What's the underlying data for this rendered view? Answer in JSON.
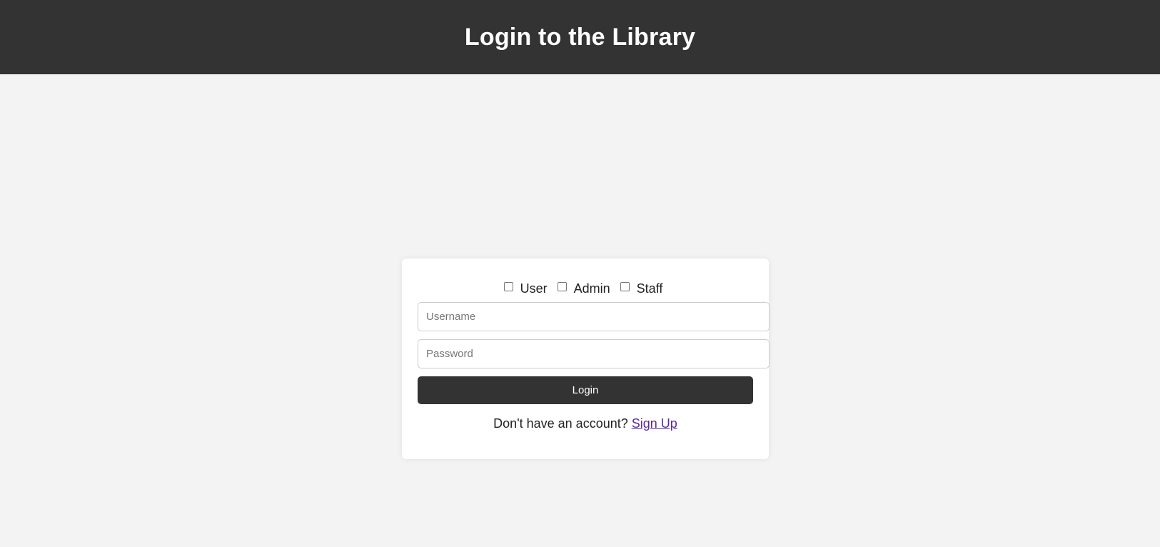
{
  "header": {
    "title": "Login to the Library"
  },
  "roles": [
    {
      "label": "User",
      "checked": false
    },
    {
      "label": "Admin",
      "checked": false
    },
    {
      "label": "Staff",
      "checked": false
    }
  ],
  "form": {
    "username_placeholder": "Username",
    "username_value": "",
    "password_placeholder": "Password",
    "password_value": "",
    "login_label": "Login"
  },
  "signup": {
    "prompt": "Don't have an account?",
    "link_label": "Sign Up"
  },
  "colors": {
    "header_bg": "#333333",
    "page_bg": "#f3f3f3",
    "button_bg": "#333333",
    "link": "#5a2aa0"
  }
}
